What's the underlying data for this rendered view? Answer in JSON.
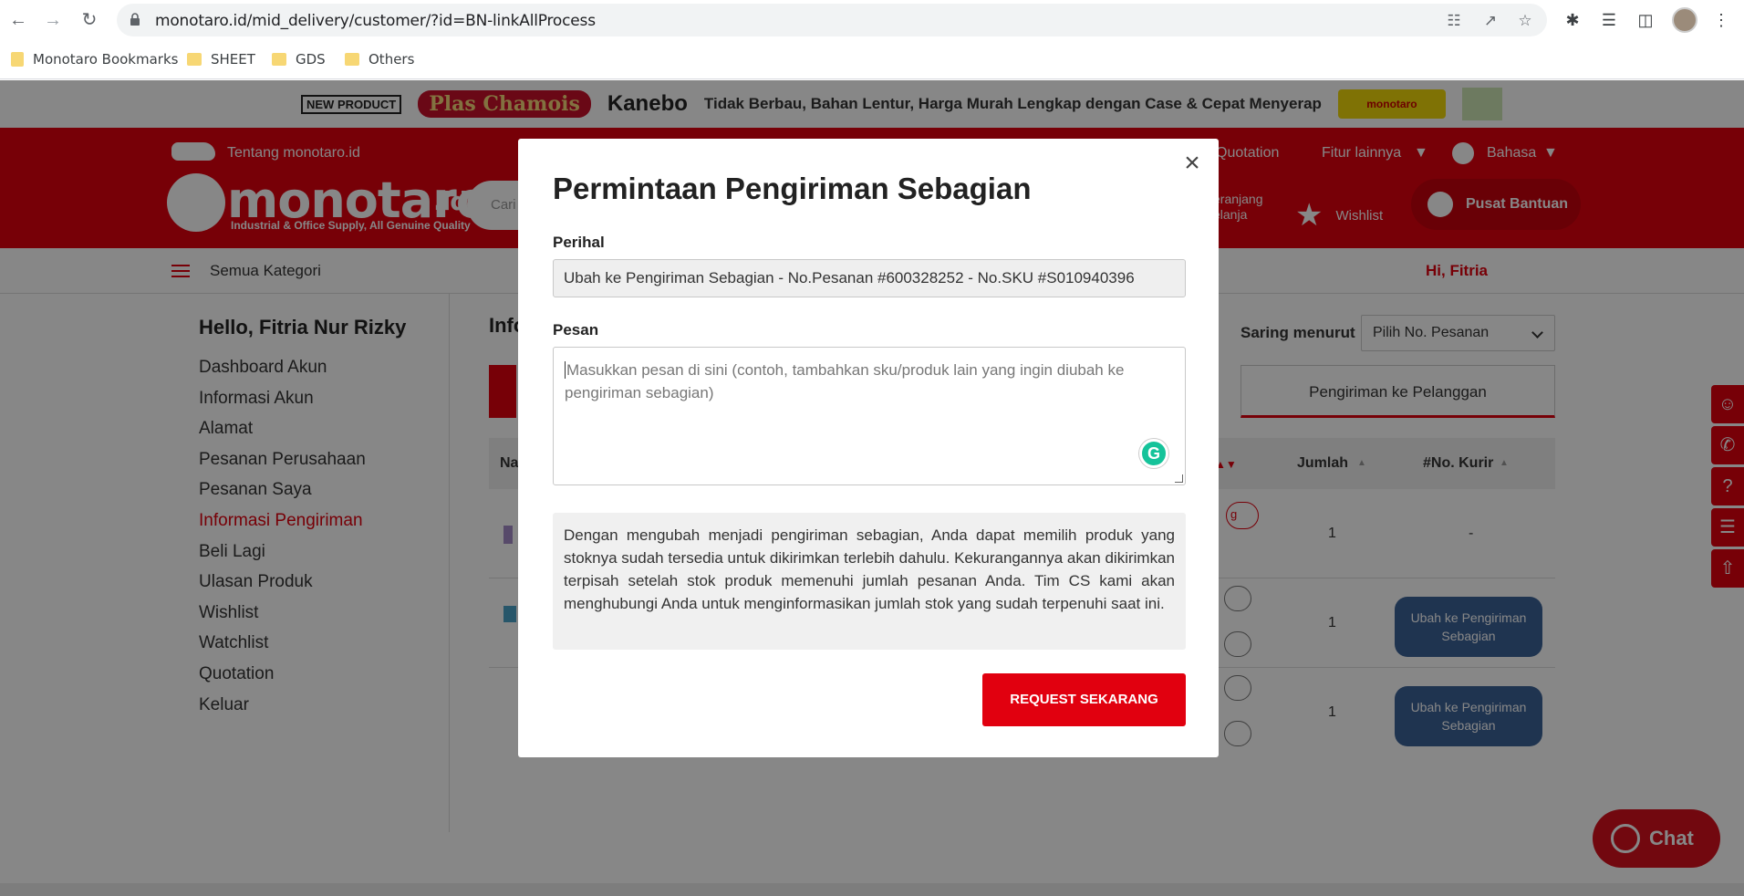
{
  "browser": {
    "url": "monotaro.id/mid_delivery/customer/?id=BN-linkAllProcess",
    "bookmarks": [
      "Monotaro Bookmarks",
      "SHEET",
      "GDS",
      "Others"
    ]
  },
  "banner": {
    "new_label": "NEW PRODUCT",
    "product": "Plas Chamois",
    "brand": "Kanebo",
    "tagline": "Tidak Berbau, Bahan Lentur, Harga Murah Lengkap dengan Case & Cepat Menyerap",
    "logo_text": "monotaro"
  },
  "header": {
    "about": "Tentang monotaro.id",
    "quotation": "Quotation",
    "more_features": "Fitur lainnya",
    "language": "Bahasa",
    "logo": "monotaro",
    "logo_suffix": ".id",
    "logo_sub": "Industrial & Office Supply, All Genuine Quality",
    "search_placeholder": "Cari",
    "cart_line1": "eranjang",
    "cart_line2": "elanja",
    "wishlist": "Wishlist",
    "help": "Pusat Bantuan"
  },
  "catbar": {
    "all_categories": "Semua Kategori",
    "greeting": "Hi, Fitria"
  },
  "sidebar": {
    "hello": "Hello, Fitria Nur Rizky",
    "items": [
      "Dashboard Akun",
      "Informasi Akun",
      "Alamat",
      "Pesanan Perusahaan",
      "Pesanan Saya",
      "Informasi Pengiriman",
      "Beli Lagi",
      "Ulasan Produk",
      "Wishlist",
      "Watchlist",
      "Quotation",
      "Keluar"
    ],
    "active_index": 5
  },
  "main": {
    "title": "Info",
    "filter_label": "Saring menurut",
    "filter_value": "Pilih No. Pesanan",
    "tab_right": "Pengiriman ke Pelanggan",
    "col_name": "Na",
    "col_qty": "Jumlah",
    "col_courier": "#No. Kurir",
    "rows": [
      {
        "qty": "1",
        "courier": "-"
      },
      {
        "qty": "1",
        "button": "Ubah ke Pengiriman Sebagian"
      },
      {
        "qty": "1",
        "button": "Ubah ke Pengiriman Sebagian"
      }
    ],
    "badge_fragment": "g"
  },
  "chat": {
    "label": "Chat"
  },
  "modal": {
    "title": "Permintaan Pengiriman Sebagian",
    "subject_label": "Perihal",
    "subject_value": "Ubah ke Pengiriman Sebagian - No.Pesanan #600328252 - No.SKU #S010940396",
    "message_label": "Pesan",
    "message_placeholder": "Masukkan pesan di sini (contoh, tambahkan sku/produk lain yang ingin diubah ke pengiriman sebagian)",
    "info": "Dengan mengubah menjadi pengiriman sebagian, Anda dapat memilih produk yang stoknya sudah tersedia untuk dikirimkan terlebih dahulu. Kekurangannya akan dikirimkan terpisah setelah stok produk memenuhi jumlah pesanan Anda. Tim CS kami akan menghubungi Anda untuk menginformasikan jumlah stok yang sudah terpenuhi saat ini.",
    "submit": "REQUEST SEKARANG",
    "close_symbol": "×"
  },
  "colors": {
    "brand_red": "#e1000f",
    "button_blue": "#3c6298",
    "grammarly": "#15c39a"
  },
  "icons": [
    "back-icon",
    "forward-icon",
    "reload-icon",
    "lock-icon",
    "translate-icon",
    "share-icon",
    "star-icon",
    "extensions-icon",
    "media-icon",
    "sidepanel-icon",
    "menu-icon",
    "close-icon",
    "grammarly-icon",
    "whatsapp-icon"
  ]
}
